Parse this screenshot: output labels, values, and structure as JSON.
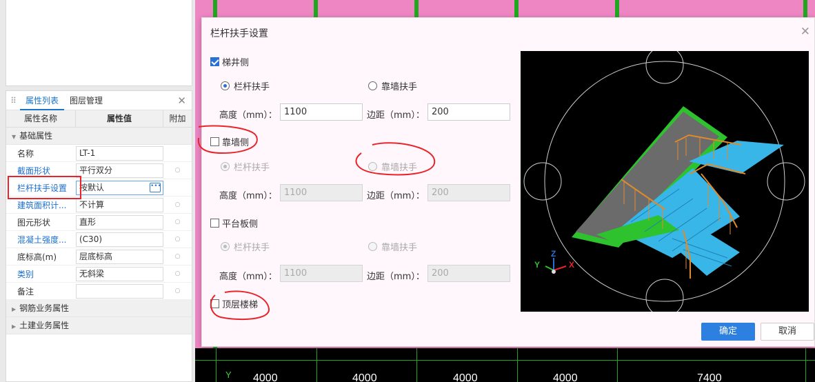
{
  "cad": {
    "dimensions": [
      "4000",
      "4000",
      "4000",
      "4000",
      "7400"
    ],
    "axis_label": "Y"
  },
  "property_panel": {
    "tabs": [
      "属性列表",
      "图层管理"
    ],
    "columns": [
      "属性名称",
      "属性值",
      "附加"
    ],
    "groups": {
      "basic": "基础属性",
      "rebar": "钢筋业务属性",
      "civil": "土建业务属性"
    },
    "rows": [
      {
        "name": "名称",
        "value": "LT-1",
        "blue": false
      },
      {
        "name": "截面形状",
        "value": "平行双分",
        "blue": true
      },
      {
        "name": "栏杆扶手设置",
        "value": "按默认",
        "blue": true
      },
      {
        "name": "建筑面积计...",
        "value": "不计算",
        "blue": true
      },
      {
        "name": "图元形状",
        "value": "直形",
        "blue": false
      },
      {
        "name": "混凝土强度...",
        "value": "(C30)",
        "blue": true
      },
      {
        "name": "底标高(m)",
        "value": "层底标高",
        "blue": false
      },
      {
        "name": "类别",
        "value": "无斜梁",
        "blue": true
      },
      {
        "name": "备注",
        "value": "",
        "blue": false
      }
    ]
  },
  "dialog": {
    "title": "栏杆扶手设置",
    "height_label": "高度（mm）：",
    "margin_label": "边距（mm）：",
    "option_railing": "栏杆扶手",
    "option_wall": "靠墙扶手",
    "sections": [
      {
        "label": "梯井侧",
        "checked": true,
        "height": "1100",
        "margin": "200",
        "enabled": true
      },
      {
        "label": "靠墙侧",
        "checked": false,
        "height": "1100",
        "margin": "200",
        "enabled": false
      },
      {
        "label": "平台板侧",
        "checked": false,
        "height": "1100",
        "margin": "200",
        "enabled": false
      }
    ],
    "top_floor": {
      "label": "顶层楼梯",
      "checked": false
    },
    "ok_label": "确定",
    "cancel_label": "取消"
  },
  "colors": {
    "accent": "#2d7fe0",
    "canvas_pink": "#ee86c4",
    "annotation_red": "#e8242a",
    "stair_blue": "#38b6e8",
    "platform_gray": "#6b6b6b",
    "rail_orange": "#e08a2e",
    "edge_green": "#2ec22e"
  }
}
